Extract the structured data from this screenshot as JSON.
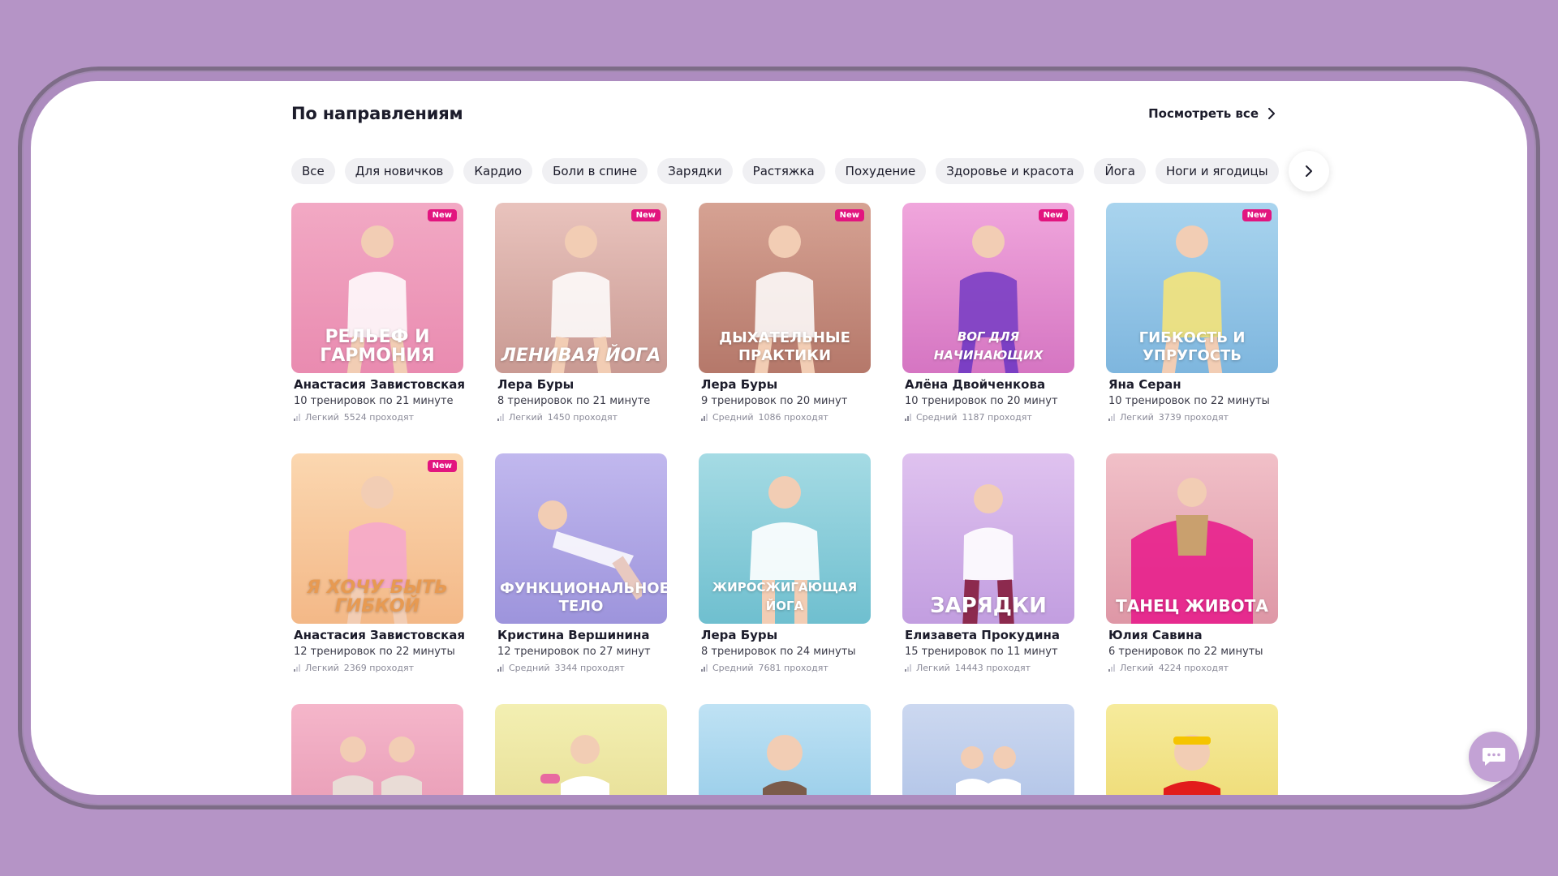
{
  "header": {
    "title": "По направлениям",
    "see_all": "Посмотреть все"
  },
  "filters": [
    "Все",
    "Для новичков",
    "Кардио",
    "Боли в спине",
    "Зарядки",
    "Растяжка",
    "Похудение",
    "Здоровье и красота",
    "Йога",
    "Ноги и ягодицы"
  ],
  "badge_label": "New",
  "cards": [
    {
      "caption": "Рельеф и гармония",
      "author": "Анастасия Завистовская",
      "info": "10 тренировок по 21 минуте",
      "level": "Легкий",
      "participants": "5524 проходят",
      "is_new": true,
      "bg_top": "#f2a9c4",
      "bg_bottom": "#e98bb0"
    },
    {
      "caption": "Ленивая йога",
      "author": "Лера Буры",
      "info": "8 тренировок по 21 минуте",
      "level": "Легкий",
      "participants": "1450 проходят",
      "is_new": true,
      "bg_top": "#e9c3bd",
      "bg_bottom": "#c99a93"
    },
    {
      "caption": "Дыхательные практики",
      "author": "Лера Буры",
      "info": "9 тренировок по 20 минут",
      "level": "Средний",
      "participants": "1086 проходят",
      "is_new": true,
      "bg_top": "#d6a293",
      "bg_bottom": "#b5786a"
    },
    {
      "caption": "Вог для начинающих",
      "author": "Алёна Двойченкова",
      "info": "10 тренировок по 20 минут",
      "level": "Средний",
      "participants": "1187 проходят",
      "is_new": true,
      "bg_top": "#f0a6dc",
      "bg_bottom": "#d575c2"
    },
    {
      "caption": "Гибкость и упругость",
      "author": "Яна Серан",
      "info": "10 тренировок по 22 минуты",
      "level": "Легкий",
      "participants": "3739 проходят",
      "is_new": true,
      "bg_top": "#a9d4ee",
      "bg_bottom": "#7eb6de"
    },
    {
      "caption": "Я хочу быть гибкой",
      "author": "Анастасия Завистовская",
      "info": "12 тренировок по 22 минуты",
      "level": "Легкий",
      "participants": "2369 проходят",
      "is_new": true,
      "bg_top": "#fbd7b0",
      "bg_bottom": "#f3b887"
    },
    {
      "caption": "Функциональное тело",
      "author": "Кристина Вершинина",
      "info": "12 тренировок по 27 минут",
      "level": "Средний",
      "participants": "3344 проходят",
      "is_new": false,
      "bg_top": "#c1b8ee",
      "bg_bottom": "#9d94dc"
    },
    {
      "caption": "Жиросжигающая йога",
      "author": "Лера Буры",
      "info": "8 тренировок по 24 минуты",
      "level": "Средний",
      "participants": "7681 проходят",
      "is_new": false,
      "bg_top": "#a5dbe4",
      "bg_bottom": "#6fbfcf"
    },
    {
      "caption": "Зарядки",
      "author": "Елизавета Прокудина",
      "info": "15 тренировок по 11 минут",
      "level": "Легкий",
      "participants": "14443 проходят",
      "is_new": false,
      "bg_top": "#dfc2ef",
      "bg_bottom": "#c29ee0"
    },
    {
      "caption": "Танец живота",
      "author": "Юлия Савина",
      "info": "6 тренировок по 22 минуты",
      "level": "Легкий",
      "participants": "4224 проходят",
      "is_new": false,
      "bg_top": "#f1c0c8",
      "bg_bottom": "#de97a6"
    }
  ],
  "cards_row3": [
    {
      "bg_top": "#f5b6ca",
      "bg_bottom": "#eaa0b9"
    },
    {
      "bg_top": "#f3efb2",
      "bg_bottom": "#e9e19a"
    },
    {
      "bg_top": "#bfe2f4",
      "bg_bottom": "#9ccfea"
    },
    {
      "bg_top": "#ccd8f0",
      "bg_bottom": "#b4c6e8"
    },
    {
      "bg_top": "#f6eb9c",
      "bg_bottom": "#efdd7a"
    }
  ],
  "colors": {
    "page_bg": "#b594c6",
    "badge": "#e2157f",
    "chip_bg": "#f0f0f3",
    "chat_button": "#c3a2d5"
  }
}
